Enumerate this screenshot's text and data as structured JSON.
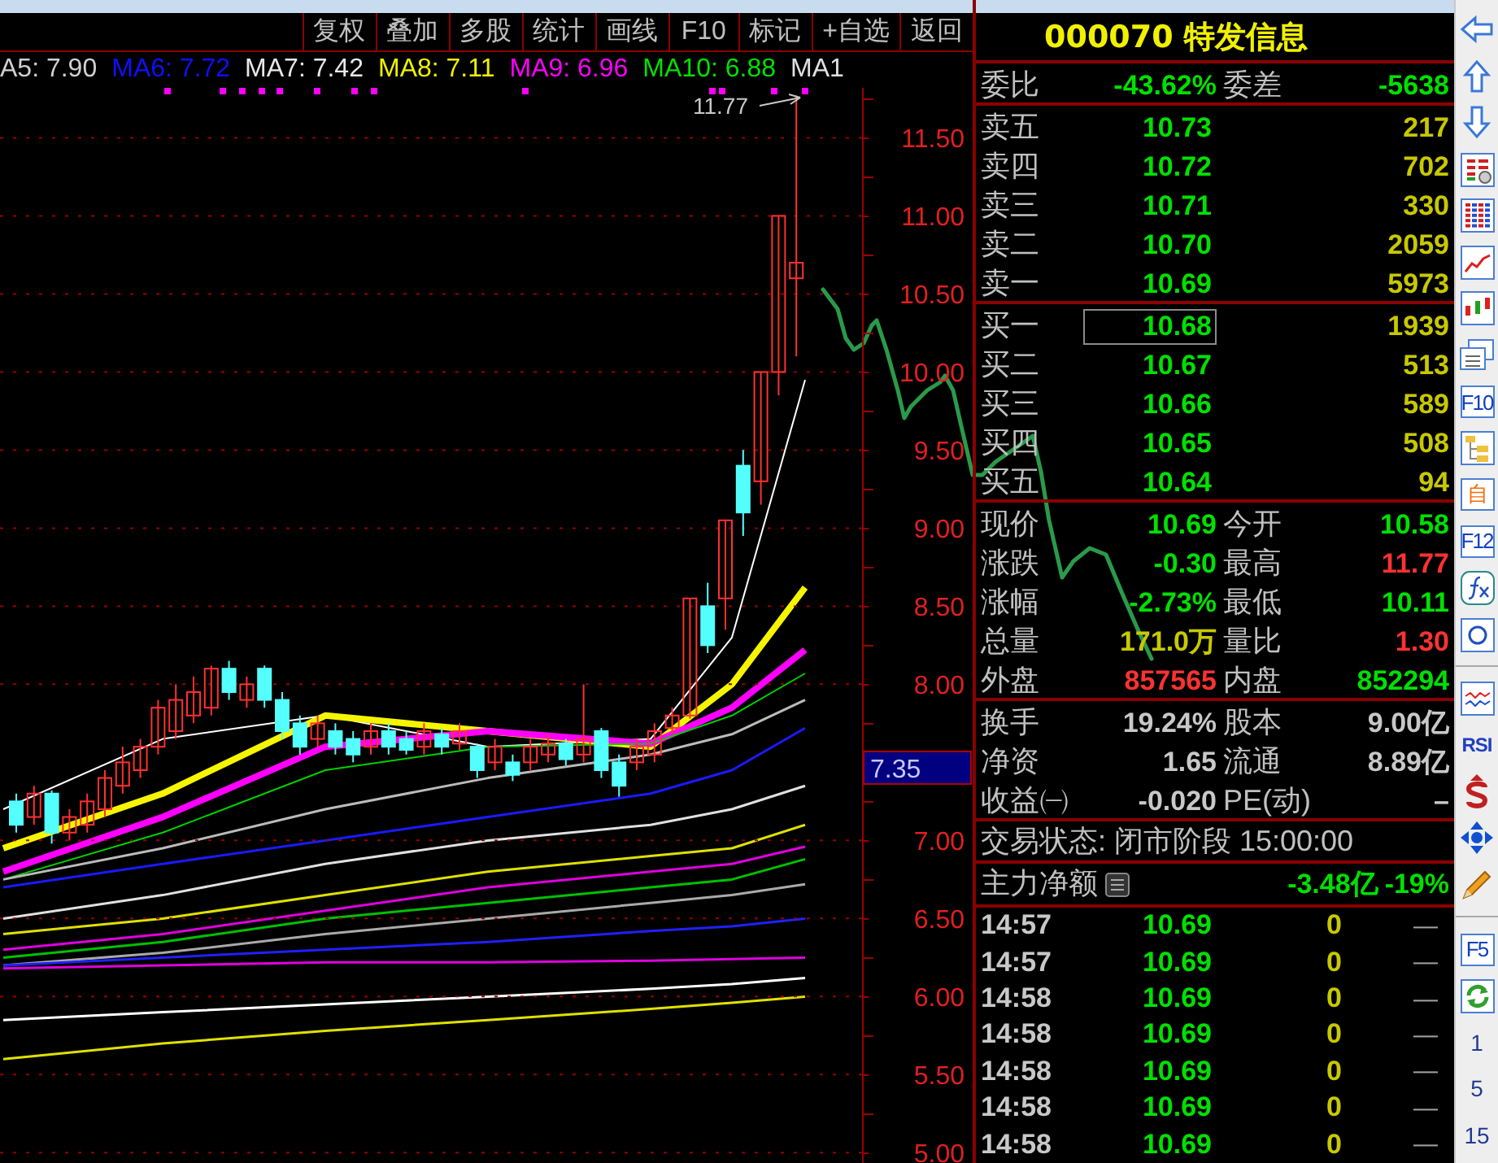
{
  "toolbar": {
    "buttons": [
      "复权",
      "叠加",
      "多股",
      "统计",
      "画线",
      "F10",
      "标记",
      "+自选",
      "返回"
    ]
  },
  "chart": {
    "ma_legend": [
      {
        "label": "A5: 7.90",
        "color": "#d0d0d0"
      },
      {
        "label": "MA6: 7.72",
        "color": "#1010ff"
      },
      {
        "label": "MA7: 7.42",
        "color": "#e8e8e8"
      },
      {
        "label": "MA8: 7.11",
        "color": "#f0f000"
      },
      {
        "label": "MA9: 6.96",
        "color": "#ff00ff"
      },
      {
        "label": "MA10: 6.88",
        "color": "#00e000"
      },
      {
        "label": "MA1",
        "color": "#e0e0e0"
      }
    ],
    "chart_data": {
      "type": "candlestick",
      "grid": true,
      "ohlc": [
        [
          7.25,
          7.3,
          7.05,
          7.1
        ],
        [
          7.15,
          7.35,
          7.1,
          7.3
        ],
        [
          7.3,
          7.32,
          6.98,
          7.05
        ],
        [
          7.05,
          7.2,
          7.0,
          7.15
        ],
        [
          7.1,
          7.3,
          7.05,
          7.25
        ],
        [
          7.2,
          7.45,
          7.15,
          7.4
        ],
        [
          7.35,
          7.6,
          7.3,
          7.5
        ],
        [
          7.45,
          7.65,
          7.4,
          7.6
        ],
        [
          7.6,
          7.9,
          7.55,
          7.85
        ],
        [
          7.7,
          8.0,
          7.65,
          7.9
        ],
        [
          7.8,
          8.05,
          7.75,
          7.95
        ],
        [
          7.85,
          8.12,
          7.8,
          8.1
        ],
        [
          8.1,
          8.15,
          7.9,
          7.95
        ],
        [
          7.9,
          8.05,
          7.85,
          8.0
        ],
        [
          8.1,
          8.12,
          7.85,
          7.9
        ],
        [
          7.9,
          7.95,
          7.65,
          7.7
        ],
        [
          7.75,
          7.8,
          7.55,
          7.6
        ],
        [
          7.65,
          7.8,
          7.6,
          7.75
        ],
        [
          7.7,
          7.75,
          7.55,
          7.6
        ],
        [
          7.65,
          7.7,
          7.5,
          7.55
        ],
        [
          7.6,
          7.75,
          7.55,
          7.7
        ],
        [
          7.7,
          7.75,
          7.55,
          7.6
        ],
        [
          7.65,
          7.7,
          7.55,
          7.58
        ],
        [
          7.6,
          7.75,
          7.55,
          7.7
        ],
        [
          7.68,
          7.72,
          7.55,
          7.6
        ],
        [
          7.62,
          7.75,
          7.58,
          7.7
        ],
        [
          7.6,
          7.62,
          7.4,
          7.45
        ],
        [
          7.5,
          7.65,
          7.45,
          7.6
        ],
        [
          7.5,
          7.55,
          7.38,
          7.42
        ],
        [
          7.5,
          7.65,
          7.45,
          7.6
        ],
        [
          7.55,
          7.68,
          7.5,
          7.62
        ],
        [
          7.62,
          7.65,
          7.48,
          7.52
        ],
        [
          7.55,
          8.0,
          7.5,
          7.65
        ],
        [
          7.7,
          7.72,
          7.4,
          7.45
        ],
        [
          7.5,
          7.55,
          7.28,
          7.35
        ],
        [
          7.5,
          7.65,
          7.45,
          7.6
        ],
        [
          7.55,
          7.75,
          7.5,
          7.7
        ],
        [
          7.72,
          7.85,
          7.68,
          7.8
        ],
        [
          7.8,
          8.55,
          7.78,
          8.55
        ],
        [
          8.5,
          8.65,
          8.2,
          8.25
        ],
        [
          8.55,
          9.05,
          8.35,
          9.05
        ],
        [
          9.4,
          9.5,
          8.95,
          9.1
        ],
        [
          9.3,
          10.0,
          9.15,
          10.0
        ],
        [
          10.0,
          11.0,
          9.85,
          11.0
        ],
        [
          10.6,
          11.77,
          10.1,
          10.7
        ]
      ],
      "ylim": [
        4.96,
        11.82
      ],
      "yticks": [
        {
          "value": 11.5,
          "label": "11.50"
        },
        {
          "value": 11.0,
          "label": "11.00"
        },
        {
          "value": 10.5,
          "label": "10.50"
        },
        {
          "value": 10.0,
          "label": "10.00"
        },
        {
          "value": 9.5,
          "label": "9.50"
        },
        {
          "value": 9.0,
          "label": "9.00"
        },
        {
          "value": 8.5,
          "label": "8.50"
        },
        {
          "value": 8.0,
          "label": "8.00"
        },
        {
          "value": 7.0,
          "label": "7.00"
        },
        {
          "value": 6.5,
          "label": "6.50"
        },
        {
          "value": 6.0,
          "label": "6.00"
        },
        {
          "value": 5.5,
          "label": "5.50"
        },
        {
          "value": 5.0,
          "label": "5.00"
        }
      ]
    },
    "cursor_price": "7.35",
    "high_label": "11.77"
  },
  "quote_panel": {
    "title": "000070 特发信息",
    "order_ratio": {
      "left": {
        "label": "委比",
        "value": "-43.62%",
        "color": "#00e000"
      },
      "right": {
        "label": "委差",
        "value": "-5638",
        "color": "#00e000"
      }
    },
    "asks": [
      {
        "label": "卖五",
        "price": "10.73",
        "volume": "217",
        "selected": false
      },
      {
        "label": "卖四",
        "price": "10.72",
        "volume": "702",
        "selected": false
      },
      {
        "label": "卖三",
        "price": "10.71",
        "volume": "330",
        "selected": false
      },
      {
        "label": "卖二",
        "price": "10.70",
        "volume": "2059",
        "selected": false
      },
      {
        "label": "卖一",
        "price": "10.69",
        "volume": "5973",
        "selected": false
      }
    ],
    "bids": [
      {
        "label": "买一",
        "price": "10.68",
        "volume": "1939",
        "selected": true
      },
      {
        "label": "买二",
        "price": "10.67",
        "volume": "513",
        "selected": false
      },
      {
        "label": "买三",
        "price": "10.66",
        "volume": "589",
        "selected": false
      },
      {
        "label": "买四",
        "price": "10.65",
        "volume": "508",
        "selected": false
      },
      {
        "label": "买五",
        "price": "10.64",
        "volume": "94",
        "selected": false
      }
    ],
    "quote_rows": [
      {
        "left": {
          "label": "现价",
          "value": "10.69",
          "color": "#00e000"
        },
        "right": {
          "label": "今开",
          "value": "10.58",
          "color": "#00e000"
        }
      },
      {
        "left": {
          "label": "涨跌",
          "value": "-0.30",
          "color": "#00e000"
        },
        "right": {
          "label": "最高",
          "value": "11.77",
          "color": "#ff3232"
        }
      },
      {
        "left": {
          "label": "涨幅",
          "value": "-2.73%",
          "color": "#00e000"
        },
        "right": {
          "label": "最低",
          "value": "10.11",
          "color": "#00e000"
        }
      },
      {
        "left": {
          "label": "总量",
          "value": "171.0万",
          "color": "#c8c800"
        },
        "right": {
          "label": "量比",
          "value": "1.30",
          "color": "#ff3232"
        }
      },
      {
        "left": {
          "label": "外盘",
          "value": "857565",
          "color": "#ff3232"
        },
        "right": {
          "label": "内盘",
          "value": "852294",
          "color": "#00e000"
        }
      }
    ],
    "stats_rows": [
      {
        "left": {
          "label": "换手",
          "value": "19.24%",
          "color": "#c8c8c8"
        },
        "right": {
          "label": "股本",
          "value": "9.00亿",
          "color": "#c8c8c8"
        }
      },
      {
        "left": {
          "label": "净资",
          "value": "1.65",
          "color": "#c8c8c8"
        },
        "right": {
          "label": "流通",
          "value": "8.89亿",
          "color": "#c8c8c8"
        }
      },
      {
        "left": {
          "label": "收益㈠",
          "value": "-0.020",
          "color": "#c8c8c8"
        },
        "right": {
          "label": "PE(动)",
          "value": "–",
          "color": "#c8c8c8"
        }
      }
    ],
    "trade_status": "交易状态: 闭市阶段 15:00:00",
    "main_net": {
      "label": "主力净额",
      "amount": "-3.48亿",
      "percent": "-19%"
    },
    "ticks": [
      {
        "time": "14:57",
        "price": "10.69",
        "volume": "0",
        "flag": "—"
      },
      {
        "time": "14:57",
        "price": "10.69",
        "volume": "0",
        "flag": "—"
      },
      {
        "time": "14:58",
        "price": "10.69",
        "volume": "0",
        "flag": "—"
      },
      {
        "time": "14:58",
        "price": "10.69",
        "volume": "0",
        "flag": "—"
      },
      {
        "time": "14:58",
        "price": "10.69",
        "volume": "0",
        "flag": "—"
      },
      {
        "time": "14:58",
        "price": "10.69",
        "volume": "0",
        "flag": "—"
      },
      {
        "time": "14:58",
        "price": "10.69",
        "volume": "0",
        "flag": "—"
      }
    ]
  },
  "sidebar": {
    "items": [
      {
        "kind": "icon"
      },
      {
        "kind": "icon"
      },
      {
        "kind": "icon"
      },
      {
        "kind": "icon"
      },
      {
        "kind": "icon"
      },
      {
        "kind": "icon"
      },
      {
        "kind": "icon"
      },
      {
        "kind": "icon"
      },
      {
        "kind": "boxed",
        "label": "F10",
        "color": "#1040c0"
      },
      {
        "kind": "icon"
      },
      {
        "kind": "boxed",
        "label": "自",
        "color": "#f07010"
      },
      {
        "kind": "boxed",
        "label": "F12",
        "color": "#1040c0"
      },
      {
        "kind": "icon"
      },
      {
        "kind": "icon"
      },
      {
        "kind": "divider"
      },
      {
        "kind": "icon"
      },
      {
        "kind": "bold",
        "label": "RSI"
      },
      {
        "kind": "icon"
      },
      {
        "kind": "icon"
      },
      {
        "kind": "icon"
      },
      {
        "kind": "divider"
      },
      {
        "kind": "boxed",
        "label": "F5",
        "color": "#1040c0"
      },
      {
        "kind": "icon"
      },
      {
        "kind": "plain",
        "label": "1"
      },
      {
        "kind": "plain",
        "label": "5"
      },
      {
        "kind": "plain",
        "label": "15"
      }
    ]
  }
}
